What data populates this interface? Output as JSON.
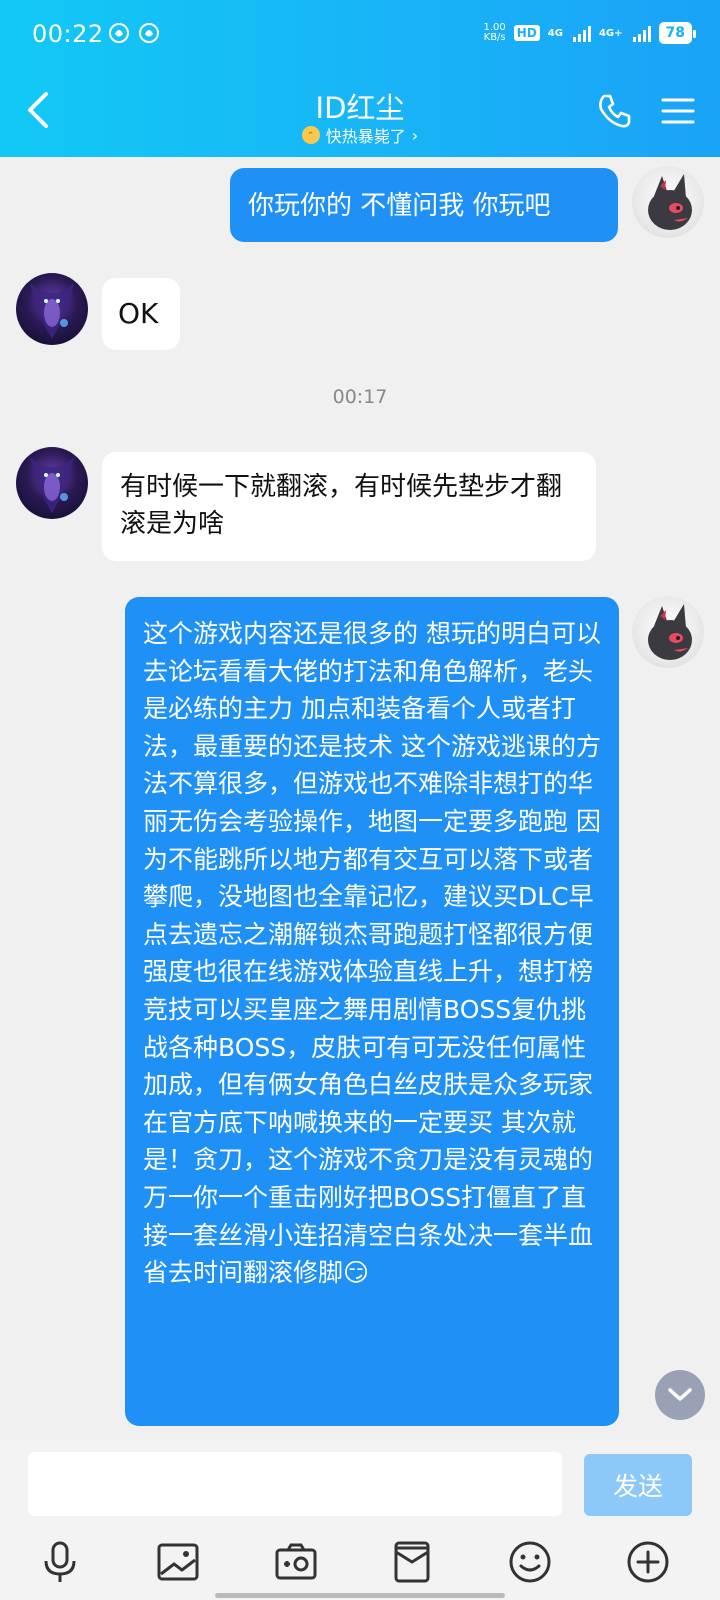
{
  "status_bar": {
    "time": "00:22",
    "net_speed_value": "1.00",
    "net_speed_unit": "KB/s",
    "hd_label": "HD",
    "sim1_label": "4G",
    "sim2_label": "4G+",
    "battery": "78"
  },
  "header": {
    "title": "ID红尘",
    "subtitle": "快热暴毙了",
    "subtitle_chevron": "›"
  },
  "messages": {
    "m1": "你玩你的 不懂问我 你玩吧",
    "m2": "OK",
    "timestamp": "00:17",
    "m3": "有时候一下就翻滚，有时候先垫步才翻滚是为啥",
    "m4": "这个游戏内容还是很多的 想玩的明白可以去论坛看看大佬的打法和角色解析，老头是必练的主力 加点和装备看个人或者打法，最重要的还是技术 这个游戏逃课的方法不算很多，但游戏也不难除非想打的华丽无伤会考验操作，地图一定要多跑跑 因为不能跳所以地方都有交互可以落下或者攀爬，没地图也全靠记忆，建议买DLC早点去遗忘之潮解锁杰哥跑题打怪都很方便强度也很在线游戏体验直线上升，想打榜竞技可以买皇座之舞用剧情BOSS复仇挑战各种BOSS，皮肤可有可无没任何属性加成，但有俩女角色白丝皮肤是众多玩家在官方底下呐喊换来的一定要买 其次就是！贪刀，这个游戏不贪刀是没有灵魂的 万一你一个重击刚好把BOSS打僵直了直接一套丝滑小连招清空白条处决一套半血省去时间翻滚修脚",
    "m4_emoji": "😏"
  },
  "input": {
    "placeholder": "",
    "send_label": "发送"
  },
  "toolbar_icons": [
    "microphone-icon",
    "image-icon",
    "camera-icon",
    "red-packet-icon",
    "emoji-icon",
    "plus-icon"
  ],
  "colors": {
    "header_start": "#12c9f5",
    "header_end": "#1aa3f7",
    "bubble_out": "#1e90f6",
    "bubble_in": "#ffffff",
    "send_button": "#8cc9f8",
    "background": "#f0f0f0"
  }
}
